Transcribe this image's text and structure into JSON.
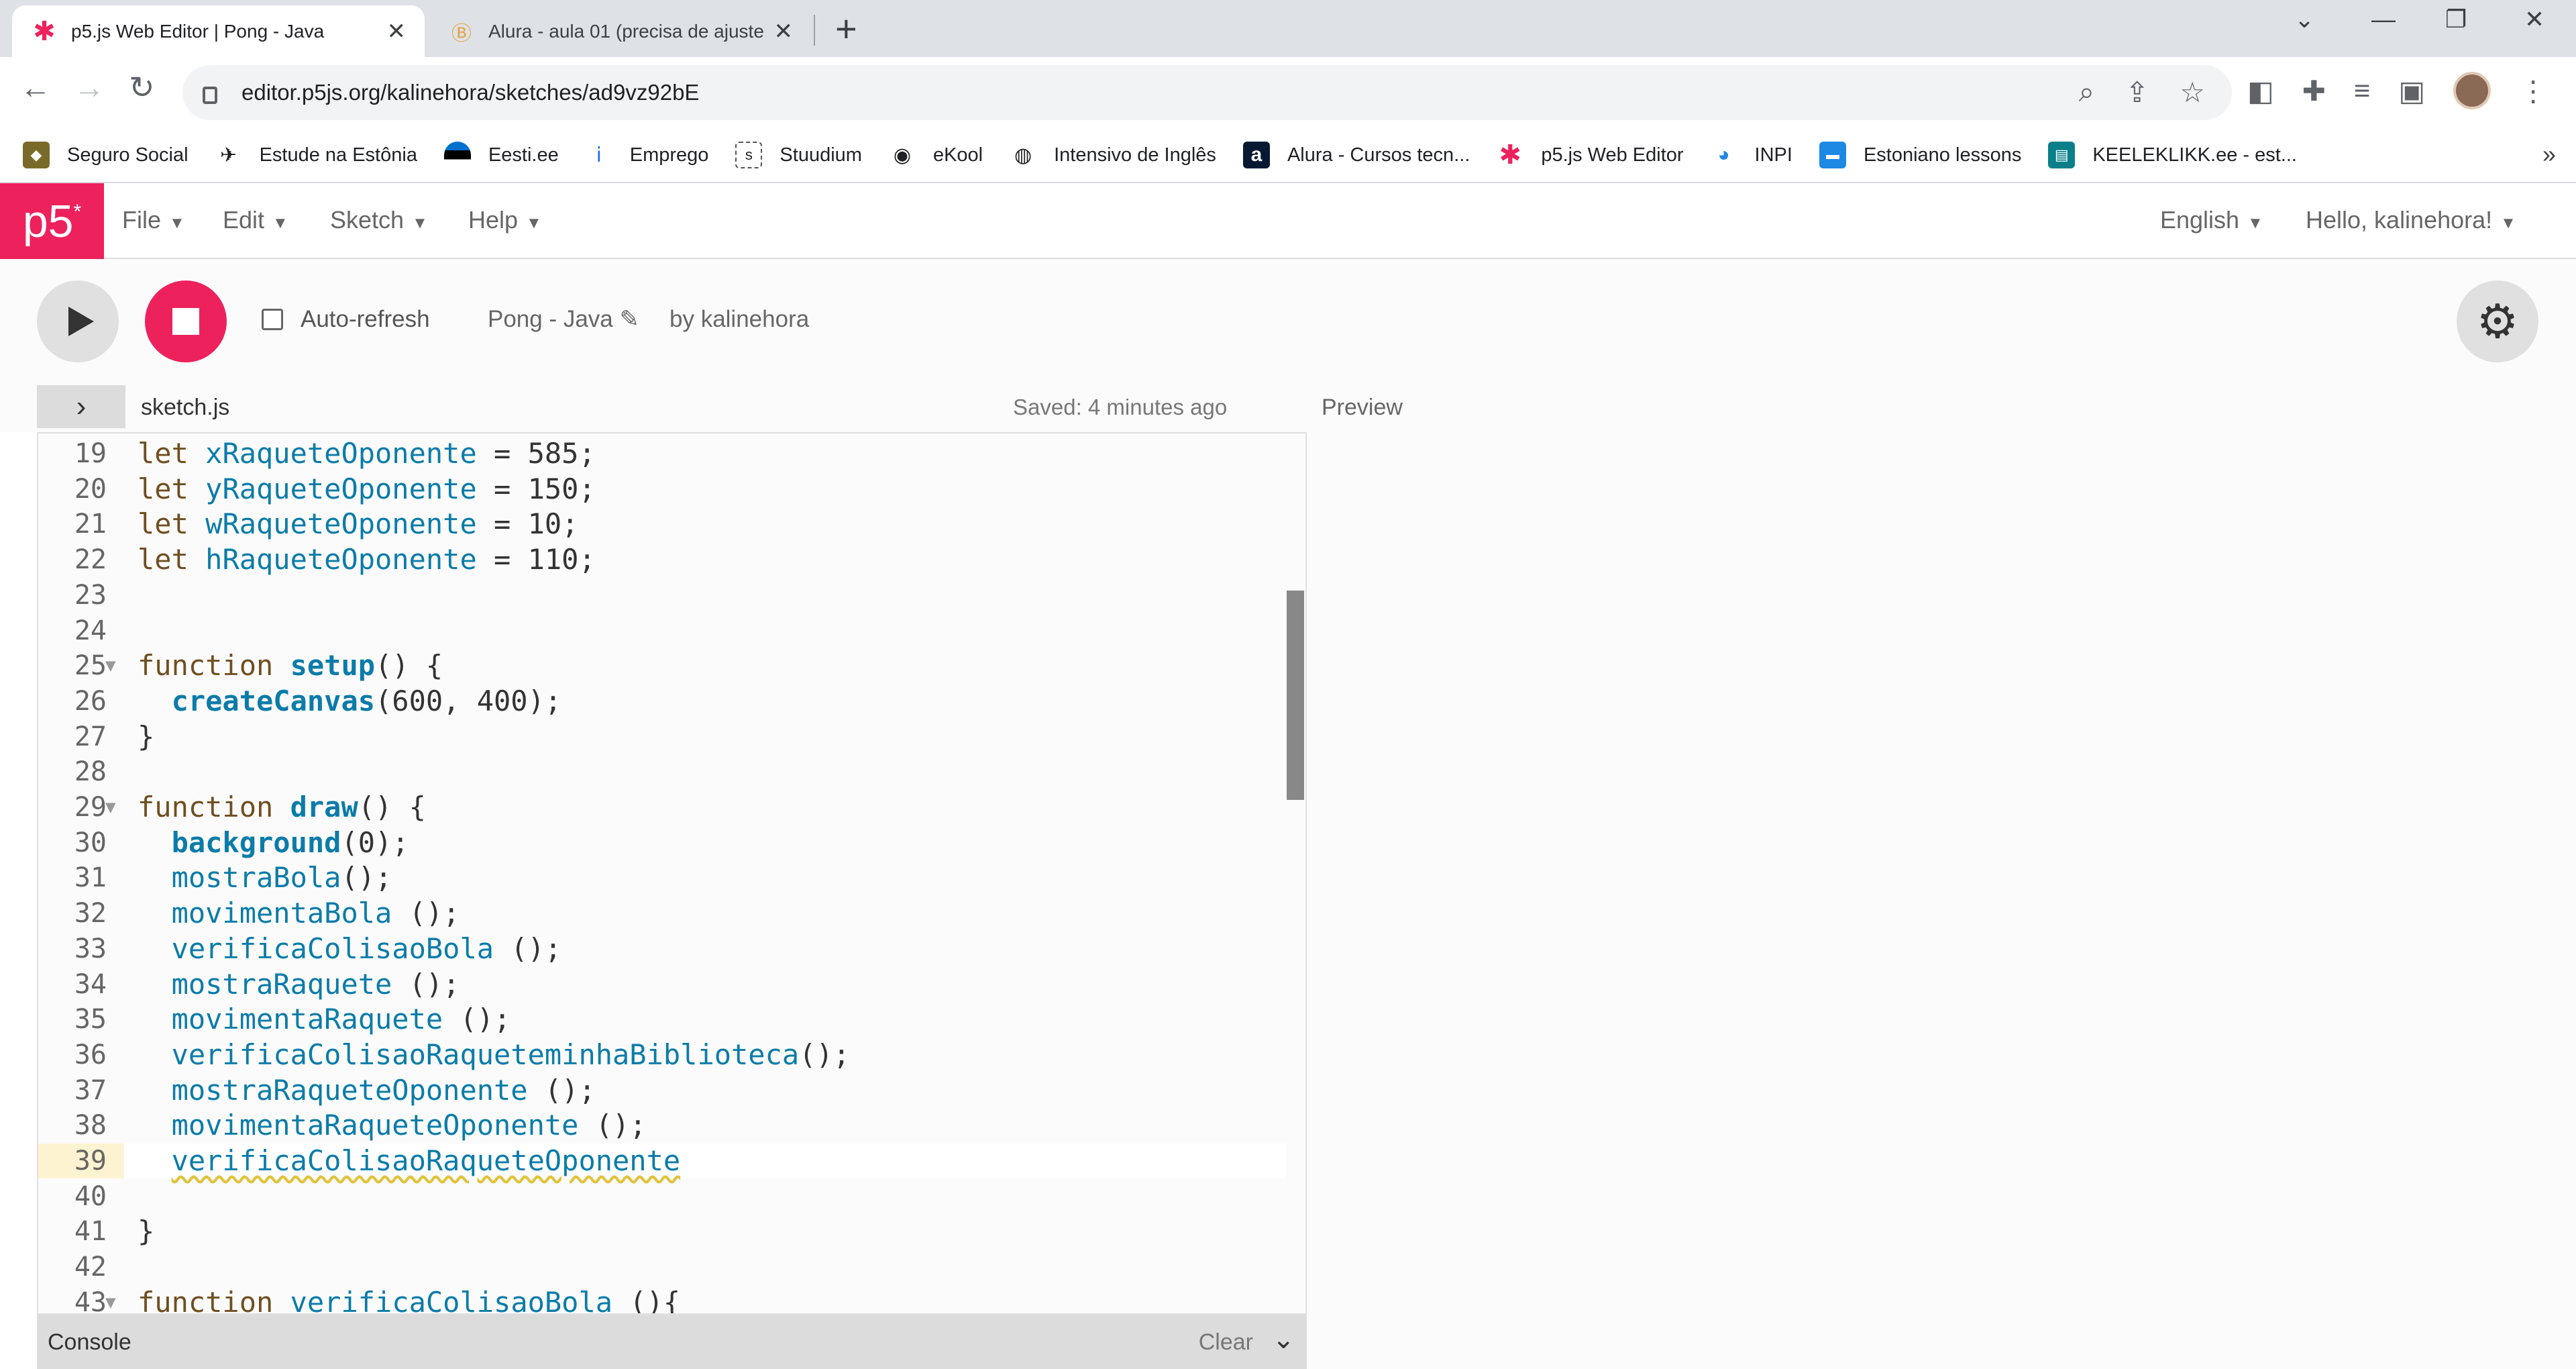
{
  "browser": {
    "tabs": [
      {
        "title": "p5.js Web Editor | Pong - Java",
        "icon": "p5-asterisk-icon",
        "active": true
      },
      {
        "title": "Alura - aula 01 (precisa de ajuste",
        "icon": "alura-b-icon",
        "active": false
      }
    ],
    "url": "editor.p5js.org/kalinehora/sketches/ad9vz92bE",
    "bookmarks": [
      {
        "label": "Seguro Social",
        "icon": "seguro-social-icon"
      },
      {
        "label": "Estude na Estônia",
        "icon": "paper-plane-icon"
      },
      {
        "label": "Eesti.ee",
        "icon": "eesti-flag-icon"
      },
      {
        "label": "Emprego",
        "icon": "info-icon"
      },
      {
        "label": "Stuudium",
        "icon": "stuudium-icon"
      },
      {
        "label": "eKool",
        "icon": "ekool-owl-icon"
      },
      {
        "label": "Intensivo de Inglês",
        "icon": "globe-icon"
      },
      {
        "label": "Alura - Cursos tecn...",
        "icon": "alura-a-icon"
      },
      {
        "label": "p5.js Web Editor",
        "icon": "p5-asterisk-icon"
      },
      {
        "label": "INPI",
        "icon": "inpi-icon"
      },
      {
        "label": "Estoniano lessons",
        "icon": "lessons-icon"
      },
      {
        "label": "KEELEKLIKK.ee - est...",
        "icon": "keeleklikk-icon"
      }
    ],
    "more_bookmarks": "»"
  },
  "p5": {
    "logo": "p5",
    "menus": {
      "file": "File",
      "edit": "Edit",
      "sketch": "Sketch",
      "help": "Help",
      "language": "English",
      "user": "Hello, kalinehora!"
    },
    "toolbar": {
      "auto_refresh": "Auto-refresh",
      "sketch_name": "Pong - Java",
      "by_user": "by kalinehora"
    },
    "editor": {
      "filename": "sketch.js",
      "saved": "Saved: 4 minutes ago",
      "preview": "Preview",
      "highlighted_line": "39",
      "lines": [
        {
          "n": "19",
          "kw": "let",
          "id": "xRaqueteOponente",
          "rest": " = 585;"
        },
        {
          "n": "20",
          "kw": "let",
          "id": "yRaqueteOponente",
          "rest": " = 150;"
        },
        {
          "n": "21",
          "kw": "let",
          "id": "wRaqueteOponente",
          "rest": " = 10;"
        },
        {
          "n": "22",
          "kw": "let",
          "id": "hRaqueteOponente",
          "rest": " = 110;"
        },
        {
          "n": "23"
        },
        {
          "n": "24"
        },
        {
          "n": "25",
          "fold": true,
          "kw": "function",
          "def": "setup",
          "rest": "() {"
        },
        {
          "n": "26",
          "indent": true,
          "bi": "createCanvas",
          "rest": "(600, 400);"
        },
        {
          "n": "27",
          "plain": "}"
        },
        {
          "n": "28"
        },
        {
          "n": "29",
          "fold": true,
          "kw": "function",
          "def": "draw",
          "rest": "() {"
        },
        {
          "n": "30",
          "indent": true,
          "bi": "background",
          "rest": "(0);"
        },
        {
          "n": "31",
          "indent": true,
          "call": "mostraBola",
          "rest": "();"
        },
        {
          "n": "32",
          "indent": true,
          "call": "movimentaBola",
          "rest": " ();"
        },
        {
          "n": "33",
          "indent": true,
          "call": "verificaColisaoBola",
          "rest": " ();"
        },
        {
          "n": "34",
          "indent": true,
          "call": "mostraRaquete",
          "rest": " ();"
        },
        {
          "n": "35",
          "indent": true,
          "call": "movimentaRaquete",
          "rest": " ();"
        },
        {
          "n": "36",
          "indent": true,
          "call": "verificaColisaoRaqueteminhaBiblioteca",
          "rest": "();"
        },
        {
          "n": "37",
          "indent": true,
          "call": "mostraRaqueteOponente",
          "rest": " ();"
        },
        {
          "n": "38",
          "indent": true,
          "call": "movimentaRaqueteOponente",
          "rest": " ();"
        },
        {
          "n": "39",
          "indent": true,
          "squiggle": "verificaColisaoRaqueteOponente"
        },
        {
          "n": "40"
        },
        {
          "n": "41",
          "plain": "}"
        },
        {
          "n": "42"
        },
        {
          "n": "43",
          "fold": true,
          "kw": "function",
          "def2": "verificaColisaoBola",
          "rest": " (){"
        }
      ]
    },
    "console": {
      "label": "Console",
      "clear": "Clear"
    }
  },
  "colors": {
    "p5_pink": "#ed225d",
    "keyword": "#704f21",
    "identifier": "#0b7ca9"
  }
}
